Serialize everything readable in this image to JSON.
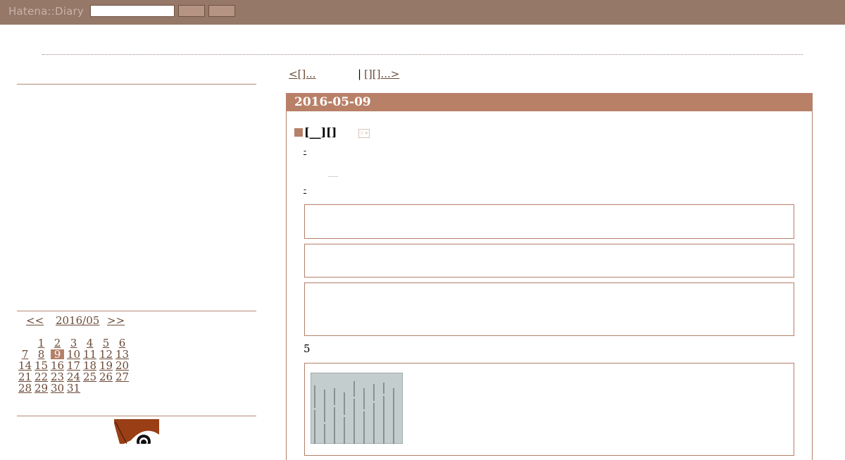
{
  "topbar": {
    "logo": "Hatena::Diary",
    "search_value": "",
    "colors": {
      "bar": "#967868",
      "button": "#b59483"
    }
  },
  "sidebar": {
    "calendar": {
      "prev": "<<",
      "month": "2016/05",
      "next": ">>",
      "today": "9",
      "weeks": [
        [
          "",
          "1",
          "2",
          "3",
          "4",
          "5",
          "6",
          "7"
        ],
        [
          "8",
          "9",
          "10",
          "11",
          "12",
          "13",
          "14"
        ],
        [
          "15",
          "16",
          "17",
          "18",
          "19",
          "20",
          "21"
        ],
        [
          "22",
          "23",
          "24",
          "25",
          "26",
          "27",
          "28"
        ],
        [
          "29",
          "30",
          "31"
        ]
      ]
    },
    "profile_icon": "profile-icon"
  },
  "main": {
    "pager": {
      "prev": "<[]...",
      "separator": "|",
      "next": "[][]...>"
    },
    "day": {
      "date": "2016-05-09",
      "section_title": "[__][]",
      "star_label": "☆+",
      "links": [
        "-",
        "-"
      ],
      "number": "5"
    },
    "accent": "#b98068"
  }
}
